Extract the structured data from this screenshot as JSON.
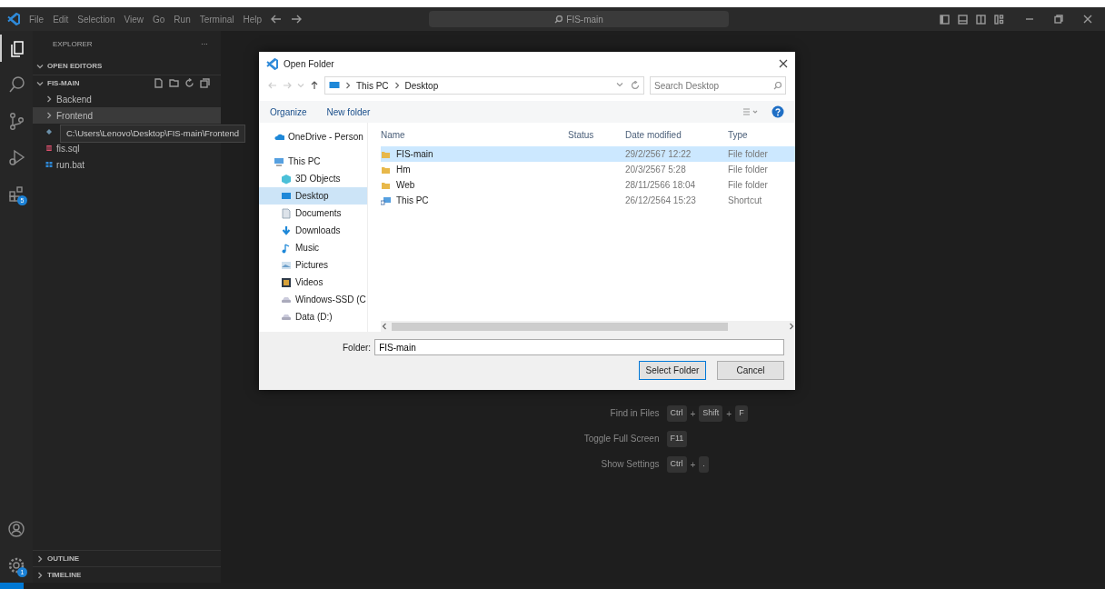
{
  "title_bar": {
    "menu": [
      "File",
      "Edit",
      "Selection",
      "View",
      "Go",
      "Run",
      "Terminal",
      "Help"
    ],
    "search_text": "FIS-main"
  },
  "activity_bar": {
    "items": [
      {
        "kind": "files",
        "selected": true
      },
      {
        "kind": "search",
        "selected": false
      },
      {
        "kind": "source-control",
        "selected": false
      },
      {
        "kind": "run",
        "selected": false
      },
      {
        "kind": "extensions",
        "selected": false,
        "badge": "5"
      }
    ],
    "bottom_items": [
      {
        "kind": "account"
      },
      {
        "kind": "settings",
        "badge": "1"
      }
    ]
  },
  "sidebar": {
    "title": "EXPLORER",
    "more": "···",
    "sections": [
      {
        "label": "OPEN EDITORS",
        "expanded": true
      },
      {
        "label": "FIS-MAIN",
        "expanded": true
      }
    ],
    "tree": [
      {
        "label": "Backend",
        "kind": "folder",
        "expanded": false,
        "selected": false
      },
      {
        "label": "Frontend",
        "kind": "folder",
        "expanded": false,
        "selected": true
      },
      {
        "kind": "config",
        "selected": false
      },
      {
        "label": "fis.sql",
        "kind": "database",
        "selected": false
      },
      {
        "label": "run.bat",
        "kind": "batch",
        "selected": false
      }
    ],
    "tooltip": "C:\\Users\\Lenovo\\Desktop\\FIS-main\\Frontend",
    "bottom_sections": [
      {
        "label": "OUTLINE",
        "expanded": false
      },
      {
        "label": "TIMELINE",
        "expanded": false
      }
    ]
  },
  "editor": {
    "shortcuts": [
      {
        "label": "Find in Files",
        "keys": [
          {
            "kind": "key",
            "text": "Ctrl"
          },
          {
            "kind": "plus",
            "text": "+"
          },
          {
            "kind": "key",
            "text": "Shift"
          },
          {
            "kind": "plus",
            "text": "+"
          },
          {
            "kind": "key",
            "text": "F"
          }
        ]
      },
      {
        "label": "Toggle Full Screen",
        "keys": [
          {
            "kind": "key",
            "text": "F11"
          }
        ]
      },
      {
        "label": "Show Settings",
        "keys": [
          {
            "kind": "key",
            "text": "Ctrl"
          },
          {
            "kind": "plus",
            "text": "+"
          },
          {
            "kind": "key",
            "text": "."
          }
        ]
      }
    ]
  },
  "dialog": {
    "title": "Open Folder",
    "breadcrumb": [
      "This PC",
      "Desktop"
    ],
    "search_placeholder": "Search Desktop",
    "toolbar": [
      "Organize",
      "New folder"
    ],
    "nav": [
      {
        "label": "OneDrive - Person",
        "kind": "cloud",
        "selected": false
      },
      {
        "label": "This PC",
        "kind": "pc",
        "selected": false,
        "children": [
          {
            "label": "3D Objects",
            "kind": "cube",
            "selected": false
          },
          {
            "label": "Desktop",
            "kind": "desktop",
            "selected": true
          },
          {
            "label": "Documents",
            "kind": "document",
            "selected": false
          },
          {
            "label": "Downloads",
            "kind": "download",
            "selected": false
          },
          {
            "label": "Music",
            "kind": "music",
            "selected": false
          },
          {
            "label": "Pictures",
            "kind": "pictures",
            "selected": false
          },
          {
            "label": "Videos",
            "kind": "video",
            "selected": false
          },
          {
            "label": "Windows-SSD (C",
            "kind": "drive",
            "selected": false
          },
          {
            "label": "Data (D:)",
            "kind": "drive",
            "selected": false
          }
        ]
      }
    ],
    "columns": [
      "Name",
      "Status",
      "Date modified",
      "Type"
    ],
    "rows": [
      {
        "name": "FIS-main",
        "kind": "folder",
        "date": "29/2/2567 12:22",
        "type": "File folder",
        "selected": true
      },
      {
        "name": "Hm",
        "kind": "folder",
        "date": "20/3/2567 5:28",
        "type": "File folder",
        "selected": false
      },
      {
        "name": "Web",
        "kind": "folder",
        "date": "28/11/2566 18:04",
        "type": "File folder",
        "selected": false
      },
      {
        "name": "This PC",
        "kind": "shortcut",
        "date": "26/12/2564 15:23",
        "type": "Shortcut",
        "selected": false
      }
    ],
    "folder_label": "Folder:",
    "folder_value": "FIS-main",
    "buttons": [
      {
        "label": "Select Folder",
        "primary": true
      },
      {
        "label": "Cancel",
        "primary": false
      }
    ]
  }
}
